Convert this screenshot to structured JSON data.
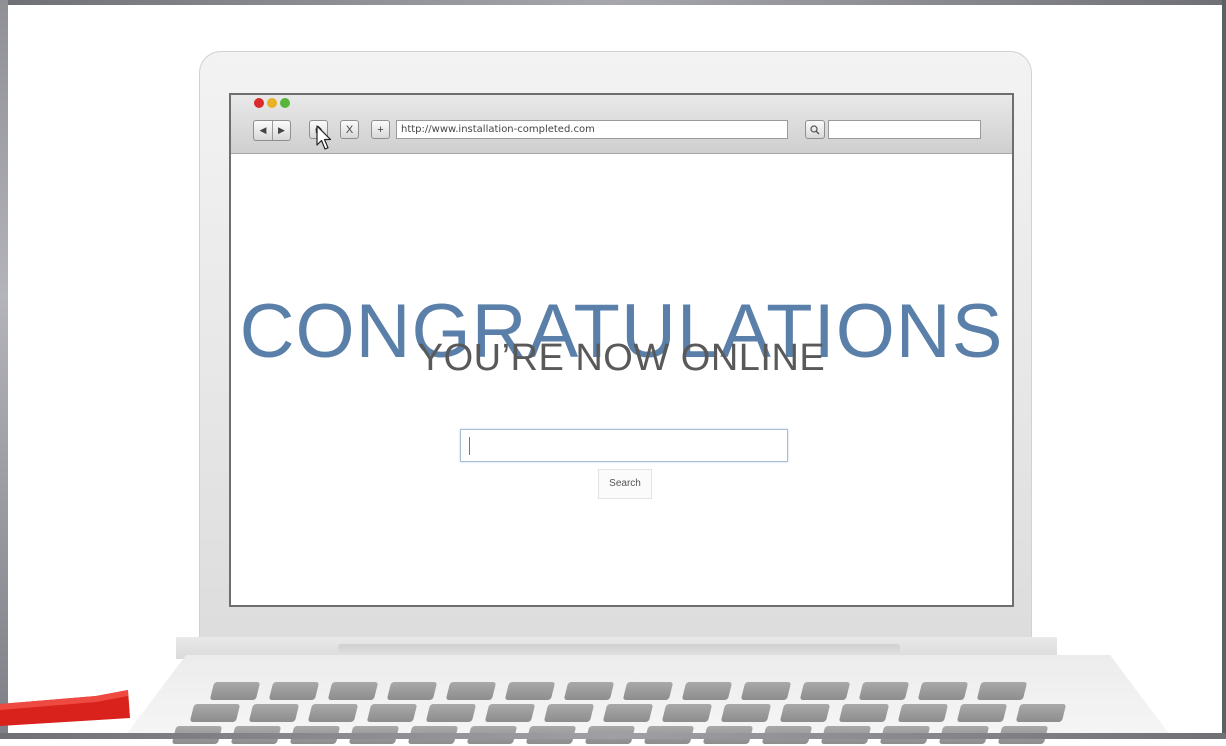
{
  "browser": {
    "url": "http://www.installation-completed.com",
    "nav": {
      "back_icon": "back-arrow-icon",
      "forward_icon": "forward-arrow-icon",
      "home_icon": "home-icon",
      "stop_icon": "close-icon",
      "new_tab_icon": "plus-icon",
      "search_icon": "magnifier-icon"
    },
    "traffic_lights": {
      "close": "#d92b2b",
      "minimize": "#e9b125",
      "zoom": "#57b63a"
    }
  },
  "page": {
    "headline": "CONGRATULATIONS",
    "subheadline": "YOU’RE NOW ONLINE",
    "search_button_label": "Search",
    "headline_color": "#5a7fa8"
  },
  "glyphs": {
    "back": "◀",
    "forward": "▶",
    "stop": "X",
    "plus": "+"
  }
}
